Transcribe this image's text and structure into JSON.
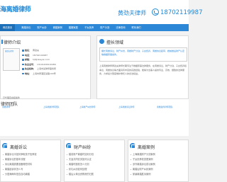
{
  "header": {
    "logo": "海离婚律师",
    "hotline_label": "黄劲夫律师",
    "phone": "18702119987"
  },
  "nav": [
    "网站首页",
    "离婚诉讼",
    "财产纠纷",
    "离婚案例",
    "婚姻家庭",
    "子女抚养",
    "财产分割",
    "法律咨询",
    "联系我们"
  ],
  "intro": {
    "title": "律师介绍",
    "photo_label": "黄劲夫律师",
    "rows": [
      {
        "label": "姓名：",
        "value": "黄劲夫"
      },
      {
        "label": "电话：",
        "value": "18702119987"
      },
      {
        "label": "邮箱：",
        "value": "hjf@lawyer.com"
      },
      {
        "label": "执业证号：",
        "value": "13101200910489"
      },
      {
        "label": "执业机构：",
        "value": "上海市某律师事务所"
      },
      {
        "label": "地址：",
        "value": "上海市黄浦区某路100号"
      }
    ],
    "count": "已代理百余起案件"
  },
  "expertise": {
    "title": "擅长领域",
    "box_text": "擅长离婚诉讼、财产纠纷、离婚财产分割、子女抚养、离婚协议起草、婚前婚后财产认定等婚姻家事案件。",
    "desc": "上海离婚律师黄劲夫律师长期专注于婚姻家事法律服务，在离婚诉讼、财产分割、子女抚养权争议、离婚协议等方面具有丰富的实践经验，能够为当事人提供专业、高效、细致的法律服务，力求最大限度维护委托人的合法权益。"
  },
  "team": {
    "title": "律师团队",
    "members": [
      "离婚律师",
      "上海离婚律师团队",
      "上海财产纠纷律师",
      "上海离婚诉讼律师",
      "离婚案件律师团队"
    ]
  },
  "columns": [
    {
      "title": "离婚诉讼",
      "items": [
        "离婚诉讼中如何争取孩子抚养权",
        "离婚诉讼的基本流程",
        "诉讼离婚需要准备哪些材料",
        "离婚起诉状怎么写",
        "分居满两年是否自动离婚"
      ]
    },
    {
      "title": "财产纠纷",
      "items": [
        "婚前房产离婚时如何分割",
        "夫妻共同债务如何认定",
        "离婚时股权怎么分割",
        "彩礼纠纷如何处理",
        "婚后父母出资购房的归属"
      ]
    },
    {
      "title": "离婚案例",
      "items": [
        "上海离婚财产分割案例",
        "子女抚养权变更案例",
        "涉外离婚诉讼成功案例",
        "离婚后财产纠纷案例",
        "家暴离婚胜诉案例"
      ]
    }
  ]
}
